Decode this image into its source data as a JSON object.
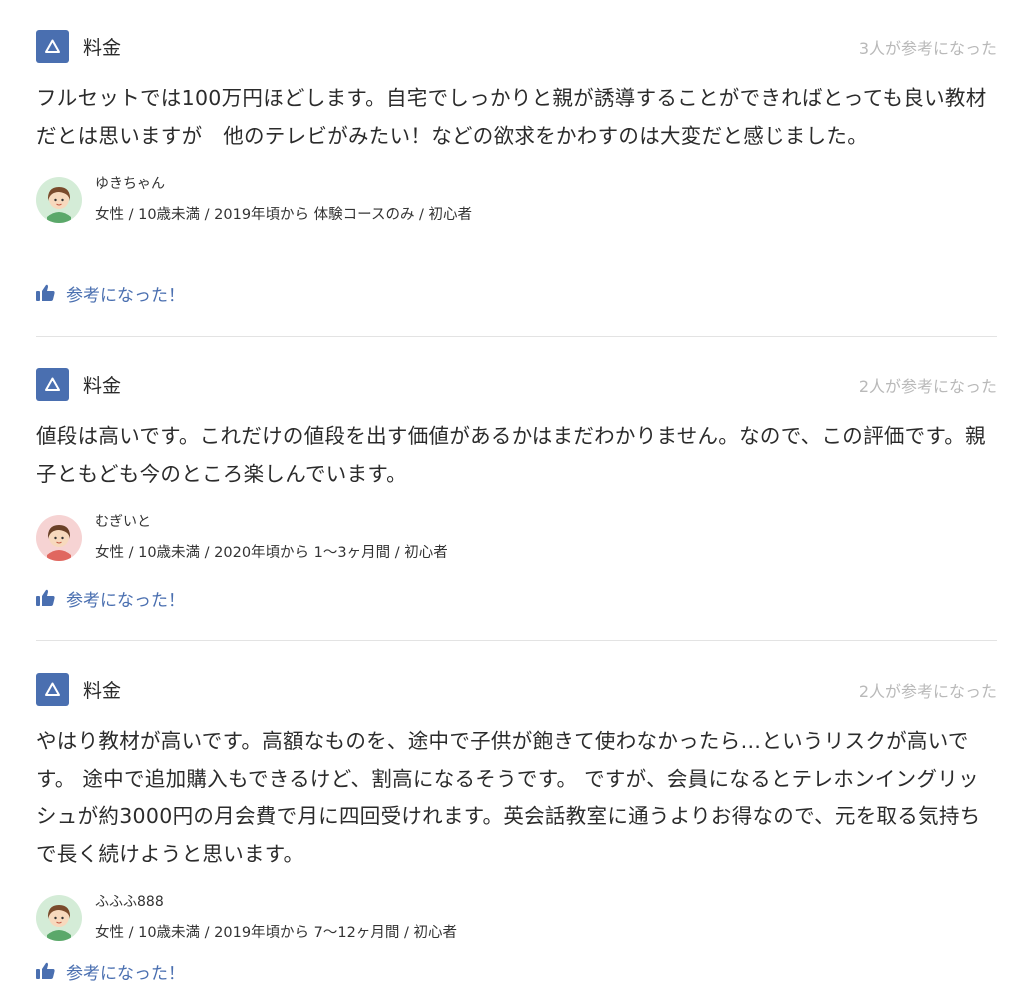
{
  "reviews": [
    {
      "category": "料金",
      "badge_symbol": "triangle-icon",
      "helpful_count_text": "3人が参考になった",
      "body": "フルセットでは100万円ほどします。自宅でしっかりと親が誘導することができればとっても良い教材だとは思いますが　他のテレビがみたい！などの欲求をかわすのは大変だと感じました。",
      "reviewer_name": "ゆきちゃん",
      "reviewer_meta": "女性 / 10歳未満 / 2019年頃から 体験コースのみ / 初心者",
      "avatar_bg": "#d4ecd7",
      "helpful_button": "参考になった！"
    },
    {
      "category": "料金",
      "badge_symbol": "triangle-icon",
      "helpful_count_text": "2人が参考になった",
      "body": "値段は高いです。これだけの値段を出す価値があるかはまだわかりません。なので、この評価です。親子ともども今のところ楽しんでいます。",
      "reviewer_name": "むぎいと",
      "reviewer_meta": "女性 / 10歳未満 / 2020年頃から 1〜3ヶ月間 / 初心者",
      "avatar_bg": "#f6d3d3",
      "helpful_button": "参考になった！"
    },
    {
      "category": "料金",
      "badge_symbol": "triangle-icon",
      "helpful_count_text": "2人が参考になった",
      "body": "やはり教材が高いです。高額なものを、途中で子供が飽きて使わなかったら…というリスクが高いです。 途中で追加購入もできるけど、割高になるそうです。 ですが、会員になるとテレホンイングリッシュが約3000円の月会費で月に四回受けれます。英会話教室に通うよりお得なので、元を取る気持ちで長く続けようと思います。",
      "reviewer_name": "ふふふ888",
      "reviewer_meta": "女性 / 10歳未満 / 2019年頃から 7〜12ヶ月間 / 初心者",
      "avatar_bg": "#d4ecd7",
      "helpful_button": "参考になった！"
    }
  ],
  "colors": {
    "accent": "#4a6fb0",
    "muted": "#b9b9b9",
    "divider": "#e3e3e3"
  }
}
